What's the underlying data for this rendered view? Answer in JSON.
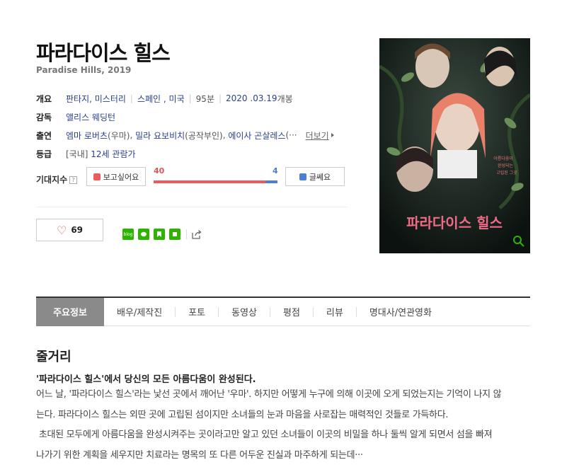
{
  "movie": {
    "title": "파라다이스 힐스",
    "subtitle": "Paradise Hills, 2019"
  },
  "info": {
    "overview_label": "개요",
    "genre": "판타지, 미스터리",
    "country": "스페인 , 미국",
    "runtime": "95분",
    "release_date": "2020 .03.19",
    "release_suffix": "개봉",
    "director_label": "감독",
    "director": "앨리스 웨딩턴",
    "cast_label": "출연",
    "cast_1": "엠마 로버츠",
    "cast_1_role": "(우마)",
    "cast_2": "밀라 요보비치",
    "cast_2_role": "(공작부인)",
    "cast_3": "에이사 곤살레스",
    "cast_3_role": "(···",
    "more_label": "더보기",
    "rating_label": "등급",
    "rating_prefix": "[국내]",
    "rating": "12세 관람가"
  },
  "expectation": {
    "label": "기대지수",
    "help_icon": "?",
    "like_label": "보고싶어요",
    "like_count": "40",
    "dislike_count": "4",
    "dislike_label": "글쎄요",
    "like_ratio": 0.9
  },
  "favorite": {
    "count": "69"
  },
  "share": {
    "blog_text": "blog",
    "icons": [
      "blog-icon",
      "line-icon",
      "bookmark-icon",
      "green-square-icon",
      "share-icon"
    ]
  },
  "tabs": [
    {
      "label": "주요정보"
    },
    {
      "label": "배우/제작진"
    },
    {
      "label": "포토"
    },
    {
      "label": "동영상"
    },
    {
      "label": "평점"
    },
    {
      "label": "리뷰"
    },
    {
      "label": "명대사/연관영화"
    }
  ],
  "synopsis": {
    "title": "줄거리",
    "lead": "'파라다이스 힐스'에서 당신의 모든 아름다움이 완성된다.",
    "line1": "어느 날, '파라다이스 힐스'라는 낯선 곳에서 깨어난 '우마'. 하지만 어떻게 누구에 의해 이곳에 오게 되었는지는 기억이 나지 않",
    "line2": "는다. 파라다이스 힐스는 외딴 곳에 고립된 섬이지만 소녀들의 눈과 마음을 사로잡는 매력적인 것들로 가득하다.",
    "line3": " 초대된 모두에게 아름다움을 완성시켜주는 곳이라고만 알고 있던 소녀들이 이곳의 비밀을 하나 둘씩 알게 되면서 섬을 빠져",
    "line4": "나가기 위한 계획을 세우지만 치료라는 명목의 또 다른 어두운 진실과 마주하게 되는데···"
  },
  "poster": {
    "title_text": "파라다이스 힐스",
    "tagline_1": "아름다움이",
    "tagline_2": "완성되는",
    "tagline_3": "고립된 그곳"
  },
  "colors": {
    "link": "#2a3f8f",
    "like": "#ee5a5a",
    "dislike": "#4a7fd6",
    "active_tab": "#8a8a8a"
  }
}
